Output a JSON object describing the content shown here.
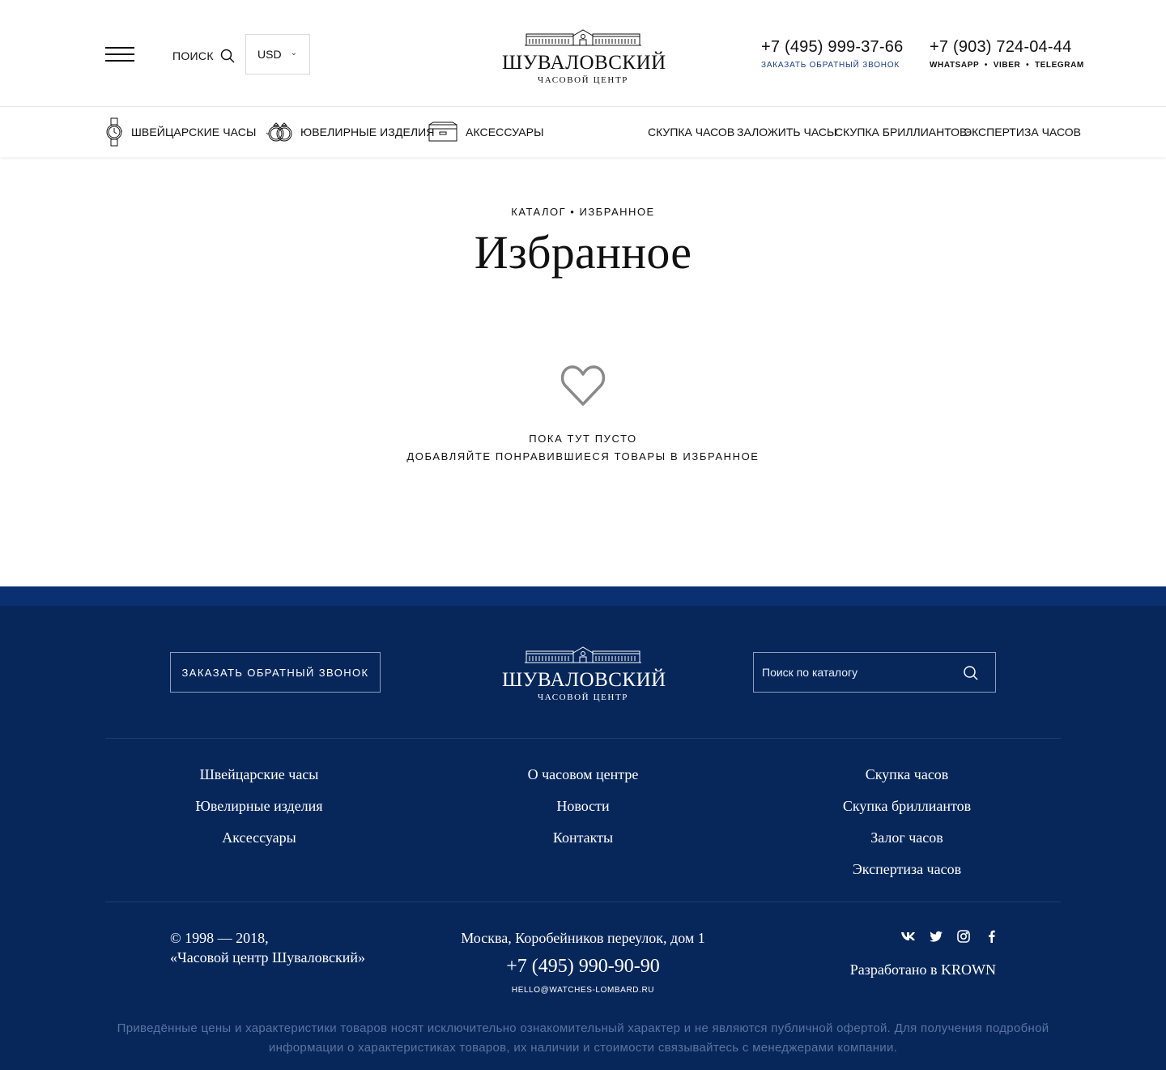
{
  "header": {
    "search_label": "ПОИСК",
    "currency": "USD",
    "logo": {
      "name": "ШУВАЛОВСКИЙ",
      "subtitle": "ЧАСОВОЙ ЦЕНТР"
    },
    "phone_primary": "+7 (495) 999-37-66",
    "callback_label": "ЗАКАЗАТЬ ОБРАТНЫЙ ЗВОНОК",
    "phone_secondary": "+7 (903) 724-04-44",
    "messengers": [
      "WHATSAPP",
      "VIBER",
      "TELEGRAM"
    ],
    "messenger_separator": "•"
  },
  "nav": {
    "categories": [
      {
        "label": "ШВЕЙЦАРСКИЕ ЧАСЫ",
        "icon": "watch-icon",
        "has_dropdown": true
      },
      {
        "label": "ЮВЕЛИРНЫЕ ИЗДЕЛИЯ",
        "icon": "rings-icon"
      },
      {
        "label": "АКСЕССУАРЫ",
        "icon": "wallet-icon"
      }
    ],
    "links": [
      "СКУПКА ЧАСОВ",
      "ЗАЛОЖИТЬ ЧАСЫ",
      "СКУПКА БРИЛЛИАНТОВ",
      "ЭКСПЕРТИЗА ЧАСОВ"
    ]
  },
  "main": {
    "breadcrumb": [
      "КАТАЛОГ",
      "ИЗБРАННОЕ"
    ],
    "breadcrumb_separator": "•",
    "title": "Избранное",
    "empty_title": "ПОКА ТУТ ПУСТО",
    "empty_subtitle": "ДОБАВЛЯЙТЕ ПОНРАВИВШИЕСЯ ТОВАРЫ В ИЗБРАННОЕ",
    "empty_icon": "heart-icon"
  },
  "footer": {
    "callback_button": "ЗАКАЗАТЬ ОБРАТНЫЙ ЗВОНОК",
    "logo": {
      "name": "ШУВАЛОВСКИЙ",
      "subtitle": "ЧАСОВОЙ ЦЕНТР"
    },
    "search_placeholder": "Поиск по каталогу",
    "columns": [
      [
        "Швейцарские часы",
        "Ювелирные изделия",
        "Аксессуары"
      ],
      [
        "О часовом центре",
        "Новости",
        "Контакты"
      ],
      [
        "Скупка часов",
        "Скупка бриллиантов",
        "Залог часов",
        "Экспертиза часов"
      ]
    ],
    "copyright_line1": "© 1998 — 2018,",
    "copyright_line2": "«Часовой центр Шуваловский»",
    "address": "Москва, Коробейников переулок, дом 1",
    "phone": "+7 (495) 990-90-90",
    "email": "HELLO@WATCHES-LOMBARD.RU",
    "socials": [
      "vk-icon",
      "twitter-icon",
      "instagram-icon",
      "facebook-icon"
    ],
    "developer": "Разработано в KROWN",
    "disclaimer": "Приведённые цены и характеристики товаров носят исключительно ознакомительный характер и не являются публичной офертой. Для получения подробной информации о характеристиках товаров, их наличии и стоимости связывайтесь с менеджерами компании."
  },
  "colors": {
    "footer_bg": "#07275b",
    "footer_band": "#0b3071",
    "accent_link": "#1c3b86",
    "disclaimer_text": "#5c73a0"
  }
}
